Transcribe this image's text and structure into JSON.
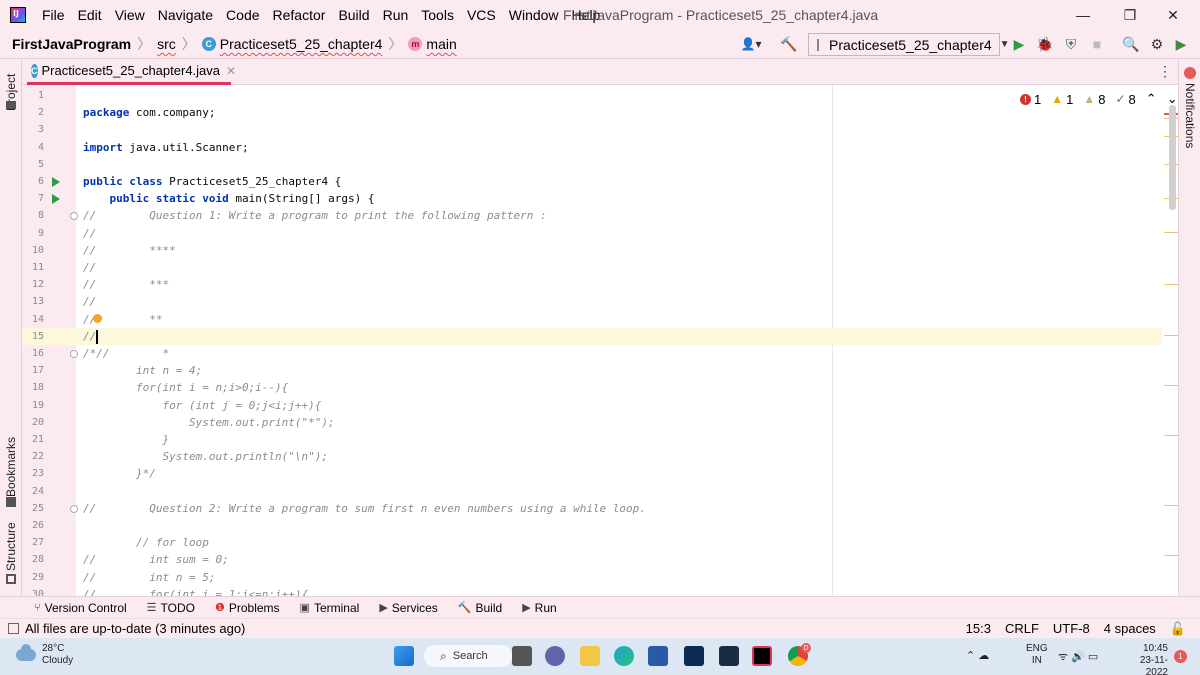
{
  "menubar": {
    "items": [
      "File",
      "Edit",
      "View",
      "Navigate",
      "Code",
      "Refactor",
      "Build",
      "Run",
      "Tools",
      "VCS",
      "Window",
      "Help"
    ],
    "title": "FirstJavaProgram - Practiceset5_25_chapter4.java",
    "logo_text": "IJ",
    "minimize": "—",
    "restore": "❐",
    "close": "✕"
  },
  "navbar": {
    "project": "FirstJavaProgram",
    "src": "src",
    "class": "Practiceset5_25_chapter4",
    "method": "main",
    "run_config": "Practiceset5_25_chapter4",
    "run_config_arrow": "▼",
    "class_badge": "C",
    "method_badge": "m",
    "user_menu": "👤▾",
    "build_glyph": "🔨",
    "run_glyph": "▶",
    "debug_glyph": "🐞",
    "coverage_glyph": "⛨",
    "stop_glyph": "■",
    "search_glyph": "🔍",
    "settings_glyph": "⚙",
    "toolbox_glyph": "▶"
  },
  "side": {
    "project": "Project",
    "bookmarks": "Bookmarks",
    "structure": "Structure",
    "notifications": "Notifications"
  },
  "tab": {
    "label": "Practiceset5_25_chapter4.java",
    "close": "✕",
    "badge": "C",
    "menu": "⋮"
  },
  "inspections": {
    "errors": "1",
    "warnings": "1",
    "weak_warnings": "8",
    "typos": "8",
    "error_glyph": "!",
    "warning_glyph": "▲",
    "weak_glyph": "▲",
    "typo_glyph": "✓",
    "up": "⌃",
    "down": "⌄"
  },
  "editor": {
    "current_line": 15,
    "lines": [
      {
        "n": "1",
        "t": ""
      },
      {
        "n": "2",
        "t": "package com.company;"
      },
      {
        "n": "3",
        "t": ""
      },
      {
        "n": "4",
        "t": "import java.util.Scanner;"
      },
      {
        "n": "5",
        "t": ""
      },
      {
        "n": "6",
        "t": "public class Practiceset5_25_chapter4 {"
      },
      {
        "n": "7",
        "t": "    public static void main(String[] args) {"
      },
      {
        "n": "8",
        "t": "//        Question 1: Write a program to print the following pattern :"
      },
      {
        "n": "9",
        "t": "//"
      },
      {
        "n": "10",
        "t": "//        ****"
      },
      {
        "n": "11",
        "t": "//"
      },
      {
        "n": "12",
        "t": "//        ***"
      },
      {
        "n": "13",
        "t": "//"
      },
      {
        "n": "14",
        "t": "//        **"
      },
      {
        "n": "15",
        "t": "//"
      },
      {
        "n": "16",
        "t": "/*//        *"
      },
      {
        "n": "17",
        "t": "        int n = 4;"
      },
      {
        "n": "18",
        "t": "        for(int i = n;i>0;i--){"
      },
      {
        "n": "19",
        "t": "            for (int j = 0;j<i;j++){"
      },
      {
        "n": "20",
        "t": "                System.out.print(\"*\");"
      },
      {
        "n": "21",
        "t": "            }"
      },
      {
        "n": "22",
        "t": "            System.out.println(\"\\n\");"
      },
      {
        "n": "23",
        "t": "        }*/"
      },
      {
        "n": "24",
        "t": ""
      },
      {
        "n": "25",
        "t": "//        Question 2: Write a program to sum first n even numbers using a while loop."
      },
      {
        "n": "26",
        "t": ""
      },
      {
        "n": "27",
        "t": "        // for loop"
      },
      {
        "n": "28",
        "t": "//        int sum = 0;"
      },
      {
        "n": "29",
        "t": "//        int n = 5;"
      },
      {
        "n": "30",
        "t": "//        for(int i = 1;i<=n;i++){"
      }
    ]
  },
  "toolwindows": [
    {
      "icon": "⑂",
      "label": "Version Control"
    },
    {
      "icon": "☰",
      "label": "TODO"
    },
    {
      "icon": "❶",
      "label": "Problems"
    },
    {
      "icon": "▣",
      "label": "Terminal"
    },
    {
      "icon": "▶",
      "label": "Services"
    },
    {
      "icon": "🔨",
      "label": "Build"
    },
    {
      "icon": "▶",
      "label": "Run"
    }
  ],
  "status": {
    "message": "All files are up-to-date (3 minutes ago)",
    "position": "15:3",
    "line_sep": "CRLF",
    "encoding": "UTF-8",
    "indent": "4 spaces",
    "lock_glyph": "🔓"
  },
  "taskbar": {
    "temp": "28°C",
    "weather": "Cloudy",
    "search": "Search",
    "search_glyph": "⌕",
    "lang1": "ENG",
    "lang2": "IN",
    "time": "10:45",
    "date": "23-11-2022",
    "notif_count": "1",
    "edge_badge": "D",
    "tray_glyphs": "⌃ ☁",
    "net_glyphs": "ᯤ 🔊 ▭"
  },
  "colors": {
    "accent": "#e0325d",
    "run": "#2b9e3f",
    "keyword": "#0033b3",
    "comment": "#8c8c8c"
  }
}
